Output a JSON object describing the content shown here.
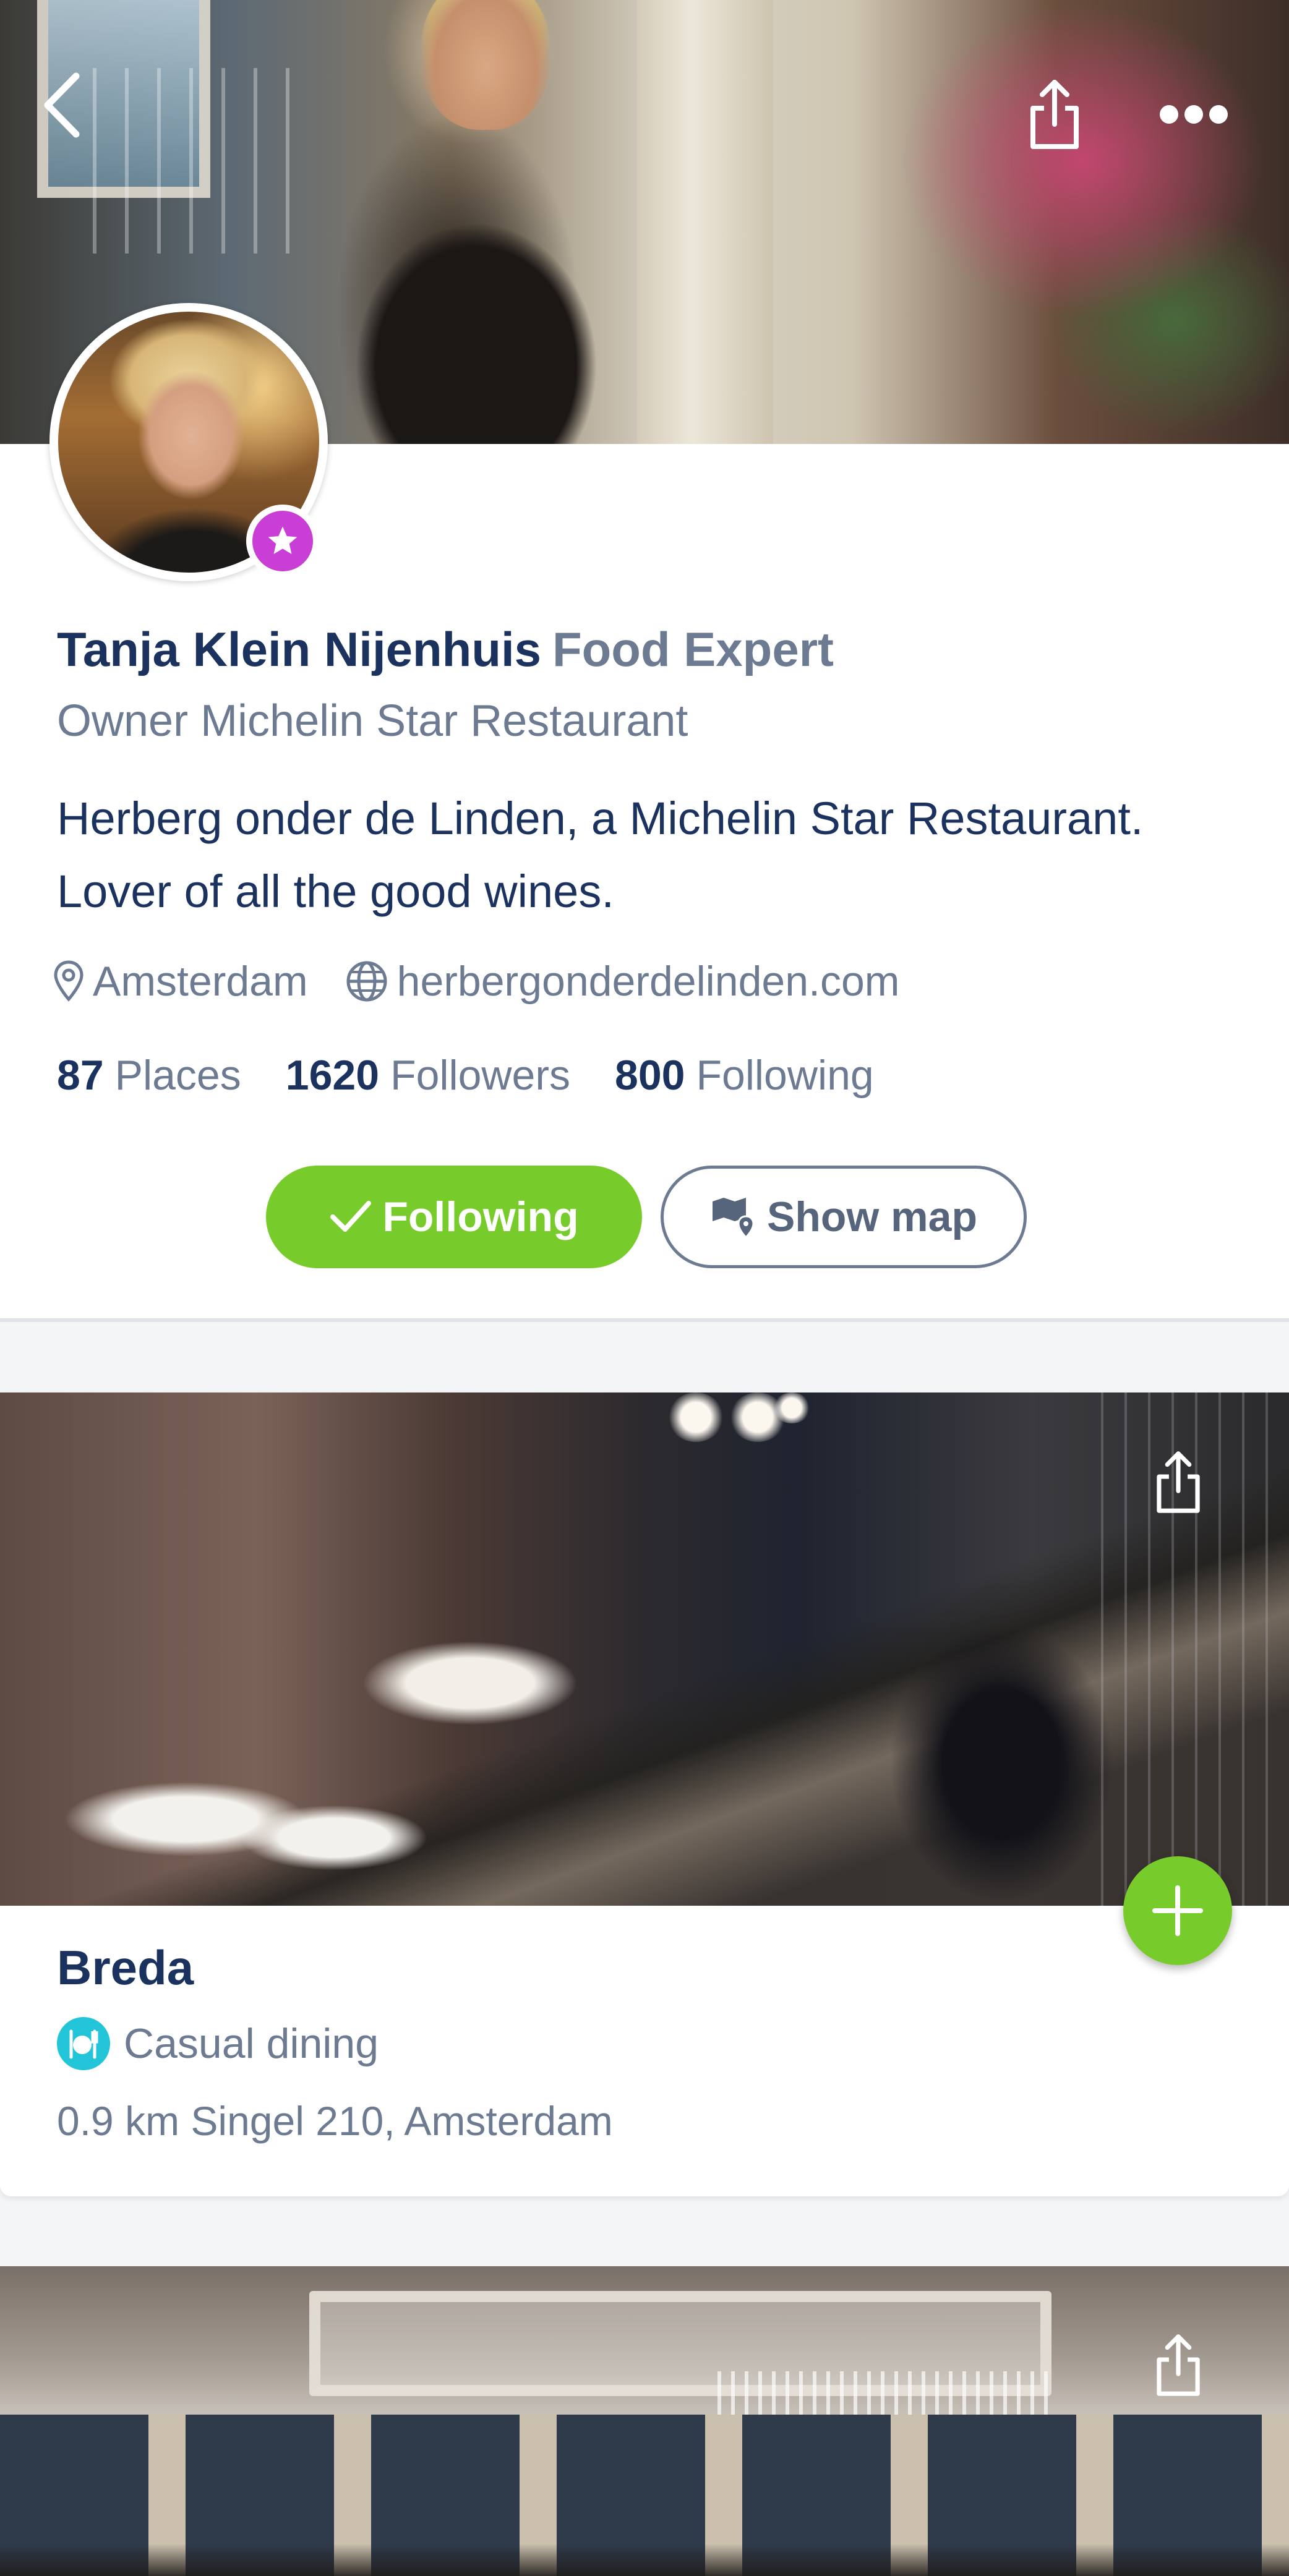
{
  "profile": {
    "name": "Tanja Klein Nijenhuis",
    "role": "Food Expert",
    "subtitle": "Owner Michelin Star Restaurant",
    "bio": "Herberg onder de Linden, a Michelin Star Restaurant. Lover of all the good wines.",
    "location": "Amsterdam",
    "website": "herbergonderdelinden.com",
    "stats": [
      {
        "value": "87",
        "label": "Places"
      },
      {
        "value": "1620",
        "label": "Followers"
      },
      {
        "value": "800",
        "label": "Following"
      }
    ],
    "follow_button": "Following",
    "map_button": "Show map"
  },
  "places": [
    {
      "name": "Breda",
      "type": "Casual dining",
      "distance": "0.9 km",
      "address": "Singel 210, Amsterdam",
      "address_line": "0.9 km Singel 210, Amsterdam"
    }
  ],
  "icons": {
    "back": "chevron-left-icon",
    "share": "share-icon",
    "more": "more-icon",
    "badge": "star-icon",
    "location": "location-pin-icon",
    "website": "globe-icon",
    "check": "check-icon",
    "map": "map-icon",
    "add": "plus-icon",
    "dining": "cutlery-icon"
  },
  "colors": {
    "primary_text": "#1b325f",
    "secondary_text": "#6c7a92",
    "accent_green": "#77cc2b",
    "badge_purple": "#c93fd6",
    "dining_teal": "#22c4d8"
  }
}
